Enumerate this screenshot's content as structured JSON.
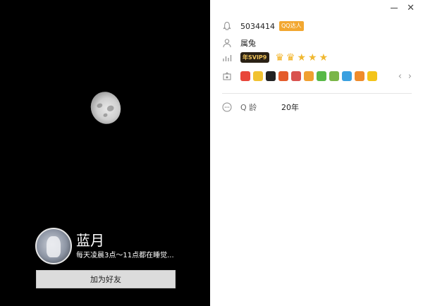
{
  "profile": {
    "nickname": "蓝月",
    "signature": "每天凌晨3点～11点都在睡觉...",
    "add_friend_label": "加为好友"
  },
  "info": {
    "qq_number": "5034414",
    "qq_badge": "QQ达人",
    "zodiac": "属兔",
    "svip_badge": "年SVIP9",
    "level_icons": [
      "crown",
      "crown",
      "crown",
      "star",
      "star"
    ],
    "service_icons": [
      "qq-show-icon",
      "qq-pet-icon",
      "qq-penguin-icon",
      "qq-red-icon",
      "qq-mail-icon",
      "qq-music-icon",
      "qq-fan-icon",
      "qq-bin-icon",
      "qq-money-icon",
      "qq-cloud-icon",
      "qq-game-icon",
      "qq-diamond-icon"
    ],
    "age_label": "Q 龄",
    "age_value": "20年"
  },
  "colors": {
    "left_bg": "#000000",
    "svip_bg": "#2a2115",
    "svip_text": "#f0c35a",
    "gold": "#f2b01e",
    "button_bg": "#dcdcdc"
  }
}
